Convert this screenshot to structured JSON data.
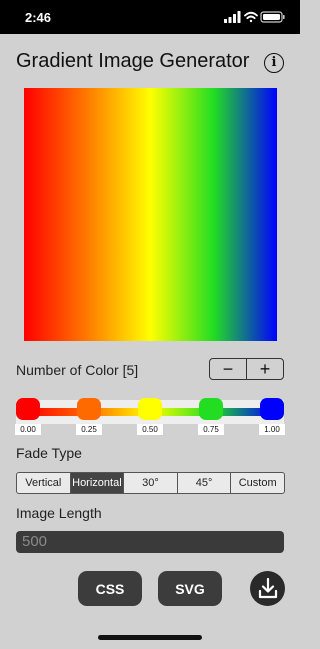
{
  "status_bar": {
    "time": "2:46"
  },
  "header": {
    "title": "Gradient Image Generator",
    "info_icon": "info-icon"
  },
  "preview": {
    "colors": [
      "#ff0000",
      "#ff7a00",
      "#ffff00",
      "#22dd22",
      "#0000ff"
    ],
    "direction": "horizontal"
  },
  "color_count": {
    "label": "Number of Color [5]",
    "minus_label": "−",
    "plus_label": "+"
  },
  "stops": [
    {
      "value": "0.00",
      "position": 0.0,
      "color": "#ff0000"
    },
    {
      "value": "0.25",
      "position": 0.25,
      "color": "#ff6a00"
    },
    {
      "value": "0.50",
      "position": 0.5,
      "color": "#ffff00"
    },
    {
      "value": "0.75",
      "position": 0.75,
      "color": "#22dd22"
    },
    {
      "value": "1.00",
      "position": 1.0,
      "color": "#0000ff"
    }
  ],
  "fade": {
    "label": "Fade Type",
    "options": [
      "Vertical",
      "Horizontal",
      "30°",
      "45°",
      "Custom"
    ],
    "selected": "Horizontal"
  },
  "length": {
    "label": "Image Length",
    "placeholder": "500"
  },
  "actions": {
    "css_label": "CSS",
    "svg_label": "SVG",
    "download_icon": "download-icon"
  }
}
